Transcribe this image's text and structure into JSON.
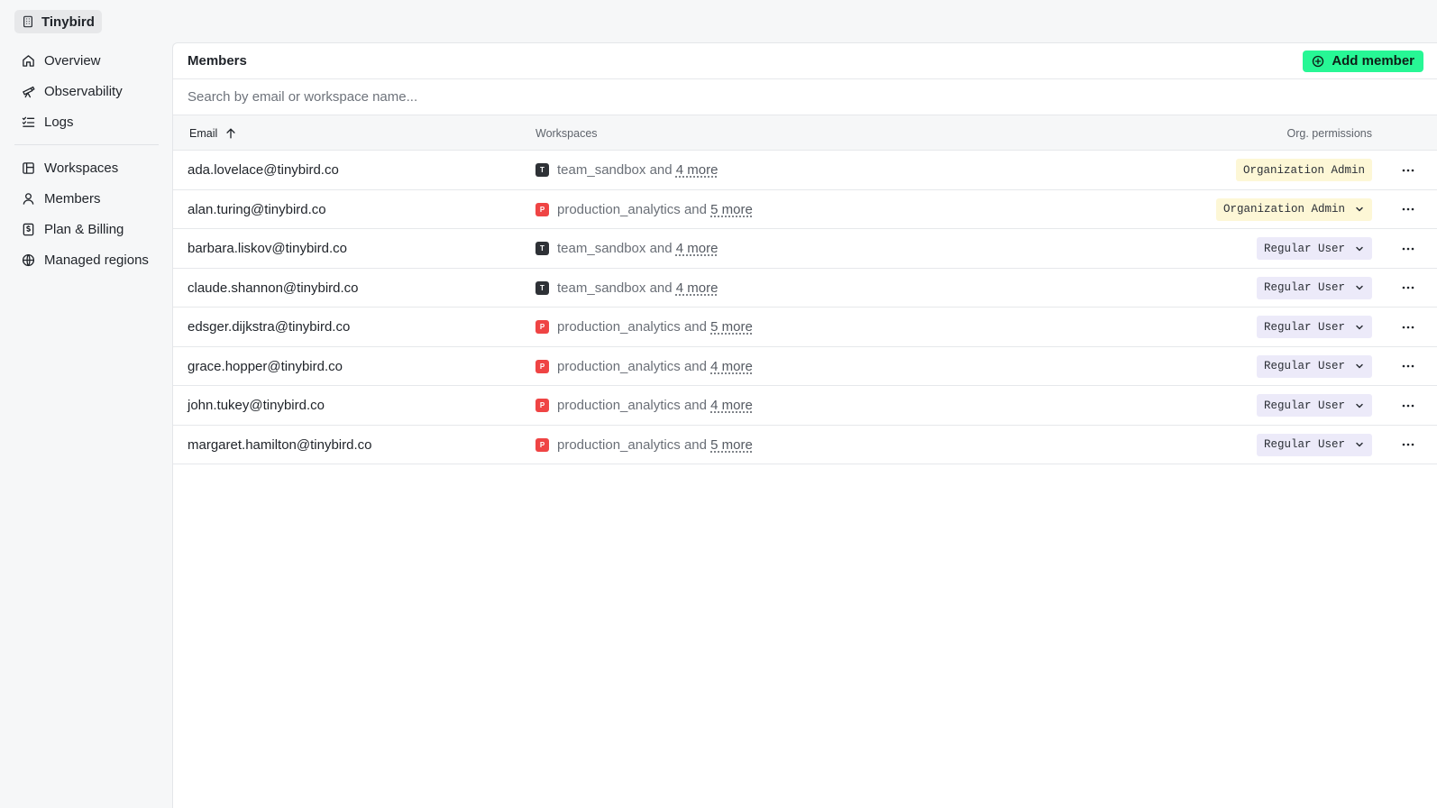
{
  "org": {
    "name": "Tinybird"
  },
  "sidebar": {
    "primary": [
      {
        "label": "Overview",
        "icon": "home-icon"
      },
      {
        "label": "Observability",
        "icon": "telescope-icon"
      },
      {
        "label": "Logs",
        "icon": "logs-icon"
      }
    ],
    "secondary": [
      {
        "label": "Workspaces",
        "icon": "workspaces-icon"
      },
      {
        "label": "Members",
        "icon": "user-icon"
      },
      {
        "label": "Plan & Billing",
        "icon": "billing-icon"
      },
      {
        "label": "Managed regions",
        "icon": "globe-icon"
      }
    ]
  },
  "header": {
    "title": "Members",
    "add_label": "Add member"
  },
  "search": {
    "placeholder": "Search by email or workspace name..."
  },
  "table": {
    "columns": {
      "email": "Email",
      "workspaces": "Workspaces",
      "permissions": "Org. permissions"
    },
    "conjunction": "and",
    "rows": [
      {
        "email": "ada.lovelace@tinybird.co",
        "ws_letter": "T",
        "ws_name": "team_sandbox",
        "ws_more": "4 more",
        "permission": "Organization Admin",
        "dropdown": false
      },
      {
        "email": "alan.turing@tinybird.co",
        "ws_letter": "P",
        "ws_name": "production_analytics",
        "ws_more": "5 more",
        "permission": "Organization Admin",
        "dropdown": true
      },
      {
        "email": "barbara.liskov@tinybird.co",
        "ws_letter": "T",
        "ws_name": "team_sandbox",
        "ws_more": "4 more",
        "permission": "Regular User",
        "dropdown": true
      },
      {
        "email": "claude.shannon@tinybird.co",
        "ws_letter": "T",
        "ws_name": "team_sandbox",
        "ws_more": "4 more",
        "permission": "Regular User",
        "dropdown": true
      },
      {
        "email": "edsger.dijkstra@tinybird.co",
        "ws_letter": "P",
        "ws_name": "production_analytics",
        "ws_more": "5 more",
        "permission": "Regular User",
        "dropdown": true
      },
      {
        "email": "grace.hopper@tinybird.co",
        "ws_letter": "P",
        "ws_name": "production_analytics",
        "ws_more": "4 more",
        "permission": "Regular User",
        "dropdown": true
      },
      {
        "email": "john.tukey@tinybird.co",
        "ws_letter": "P",
        "ws_name": "production_analytics",
        "ws_more": "4 more",
        "permission": "Regular User",
        "dropdown": true
      },
      {
        "email": "margaret.hamilton@tinybird.co",
        "ws_letter": "P",
        "ws_name": "production_analytics",
        "ws_more": "5 more",
        "permission": "Regular User",
        "dropdown": true
      }
    ]
  },
  "colors": {
    "accent": "#27f795",
    "badge_t": "#2e3136",
    "badge_p": "#ef4444",
    "admin_bg": "#fdf7d6",
    "user_bg": "#eceaf9"
  }
}
